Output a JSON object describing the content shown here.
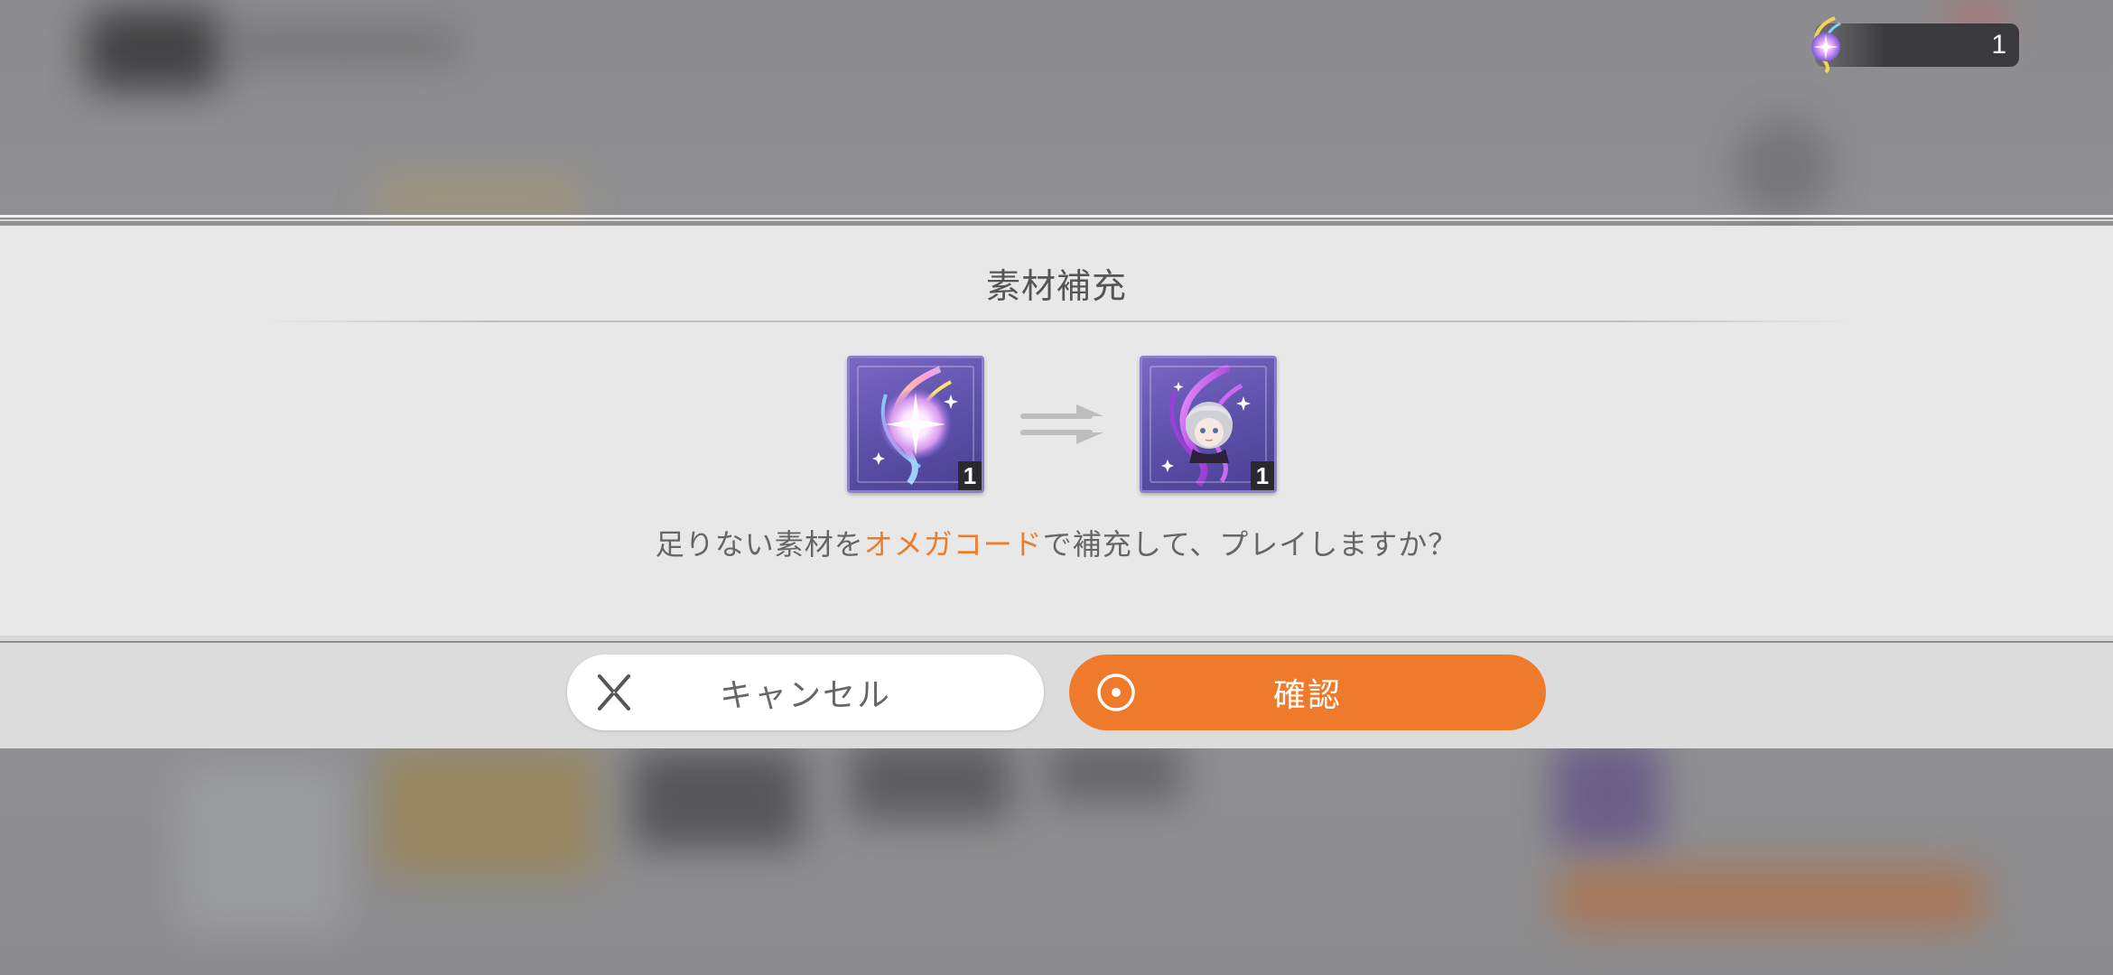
{
  "currency": {
    "icon": "omega-code-crystal-icon",
    "count": "1"
  },
  "dialog": {
    "title": "素材補充",
    "source_item": {
      "icon": "omega-code-crystal-icon",
      "count": "1"
    },
    "target_item": {
      "icon": "character-material-icon",
      "count": "1"
    },
    "message_before": "足りない素材を",
    "message_highlight": "オメガコード",
    "message_after": "で補充して、プレイしますか？",
    "cancel_label": "キャンセル",
    "confirm_label": "確認"
  },
  "colors": {
    "accent": "#ef7a2b",
    "highlight_text": "#ee7b2a",
    "tile_purple": "#5b4fa8"
  }
}
